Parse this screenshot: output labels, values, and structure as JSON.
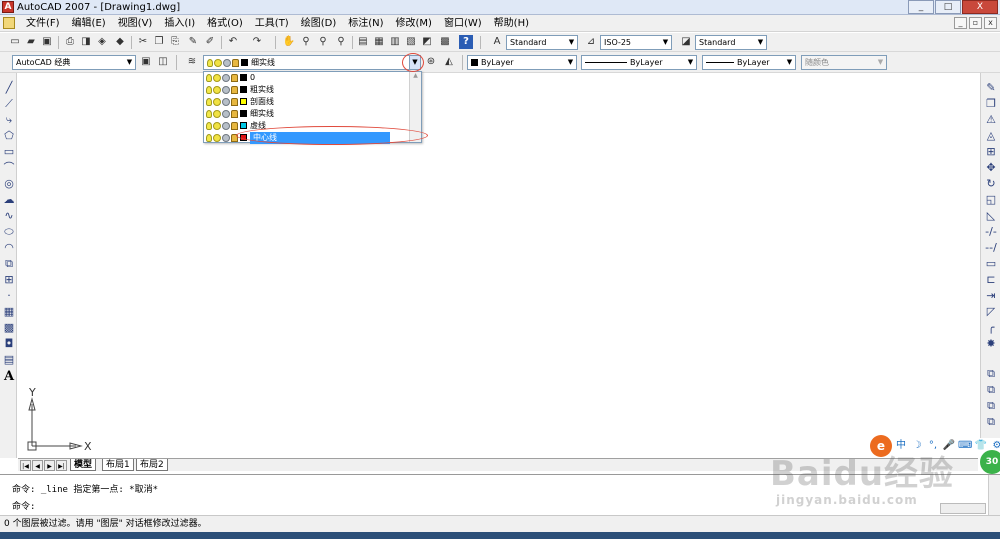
{
  "window": {
    "title": "AutoCAD 2007 - [Drawing1.dwg]",
    "app_icon_glyph": "A",
    "controls": [
      "_",
      "□",
      "X"
    ],
    "doc_controls": [
      "_",
      "▫",
      "x"
    ]
  },
  "menubar": {
    "items": [
      "文件(F)",
      "编辑(E)",
      "视图(V)",
      "插入(I)",
      "格式(O)",
      "工具(T)",
      "绘图(D)",
      "标注(N)",
      "修改(M)",
      "窗口(W)",
      "帮助(H)"
    ]
  },
  "toolbar_standard": {
    "text_style": "Standard",
    "dim_style": "ISO-25",
    "table_style": "Standard",
    "help_glyph": "?"
  },
  "toolbar_layers": {
    "workspace": "AutoCAD 经典",
    "current_layer": "细实线",
    "current_layer_color": "#000000",
    "color": "ByLayer",
    "linetype": "ByLayer",
    "lineweight": "ByLayer",
    "plot_style": "随颜色"
  },
  "layer_list": [
    {
      "name": "0",
      "color": "#000000"
    },
    {
      "name": "粗实线",
      "color": "#000000"
    },
    {
      "name": "剖面线",
      "color": "#ffff00"
    },
    {
      "name": "细实线",
      "color": "#000000"
    },
    {
      "name": "虚线",
      "color": "#00c8e6"
    },
    {
      "name": "中心线",
      "color": "#e01010",
      "selected": true
    }
  ],
  "colors": {
    "selection": "#3399ff",
    "annotation_ellipse": "#e04a3c"
  },
  "canvas": {
    "ucs_x_label": "X",
    "ucs_y_label": "Y"
  },
  "layout_tabs": [
    "模型",
    "布局1",
    "布局2"
  ],
  "command": {
    "history_line": "命令: _line 指定第一点: *取消*",
    "prompt": "命令:"
  },
  "status": {
    "text": "0 个图层被过滤。请用 \"图层\" 对话框修改过滤器。"
  },
  "ime": {
    "logo": "e",
    "items": [
      "中",
      "☽",
      "°,",
      "🎤",
      "⌨",
      "👕",
      "⚙"
    ],
    "badge": "30"
  },
  "watermark": {
    "main": "Baidu经验",
    "url": "jingyan.baidu.com"
  }
}
